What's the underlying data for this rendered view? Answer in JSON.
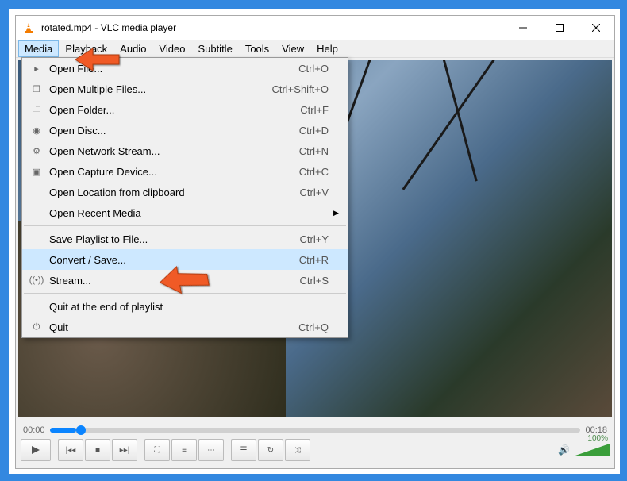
{
  "window": {
    "title": "rotated.mp4 - VLC media player"
  },
  "menubar": {
    "items": [
      {
        "label": "Media",
        "active": true
      },
      {
        "label": "Playback"
      },
      {
        "label": "Audio"
      },
      {
        "label": "Video"
      },
      {
        "label": "Subtitle"
      },
      {
        "label": "Tools"
      },
      {
        "label": "View"
      },
      {
        "label": "Help"
      }
    ]
  },
  "dropdown": {
    "groups": [
      [
        {
          "icon": "file",
          "label": "Open File...",
          "shortcut": "Ctrl+O"
        },
        {
          "icon": "files",
          "label": "Open Multiple Files...",
          "shortcut": "Ctrl+Shift+O"
        },
        {
          "icon": "folder",
          "label": "Open Folder...",
          "shortcut": "Ctrl+F"
        },
        {
          "icon": "disc",
          "label": "Open Disc...",
          "shortcut": "Ctrl+D"
        },
        {
          "icon": "net",
          "label": "Open Network Stream...",
          "shortcut": "Ctrl+N"
        },
        {
          "icon": "cap",
          "label": "Open Capture Device...",
          "shortcut": "Ctrl+C"
        },
        {
          "icon": "",
          "label": "Open Location from clipboard",
          "shortcut": "Ctrl+V"
        },
        {
          "icon": "",
          "label": "Open Recent Media",
          "shortcut": "",
          "submenu": true
        }
      ],
      [
        {
          "icon": "",
          "label": "Save Playlist to File...",
          "shortcut": "Ctrl+Y"
        },
        {
          "icon": "",
          "label": "Convert / Save...",
          "shortcut": "Ctrl+R",
          "highlight": true
        },
        {
          "icon": "stream",
          "label": "Stream...",
          "shortcut": "Ctrl+S"
        }
      ],
      [
        {
          "icon": "",
          "label": "Quit at the end of playlist",
          "shortcut": ""
        },
        {
          "icon": "quit",
          "label": "Quit",
          "shortcut": "Ctrl+Q"
        }
      ]
    ]
  },
  "player": {
    "current_time": "00:00",
    "total_time": "00:18",
    "volume_pct": "100%"
  }
}
